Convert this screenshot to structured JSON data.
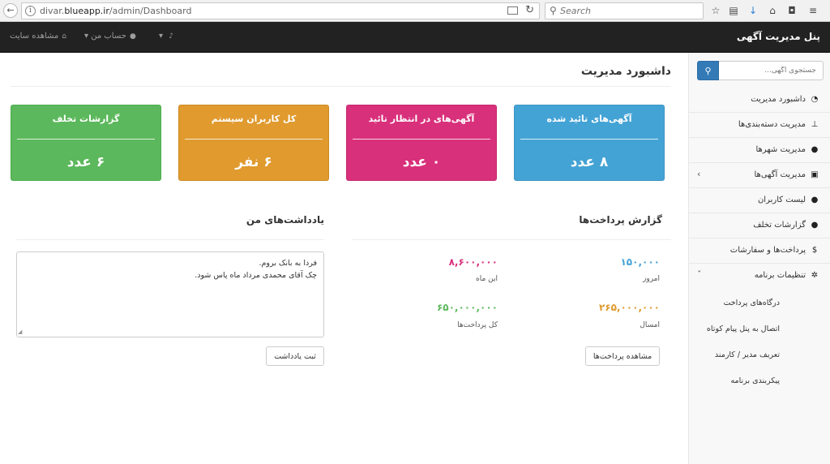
{
  "browser": {
    "url_prefix": "divar.",
    "url_domain": "blueapp.ir",
    "url_path": "/admin/Dashboard",
    "search_placeholder": "Search",
    "back_icon": "back-arrow-icon",
    "info_icon": "info-icon"
  },
  "topbar": {
    "brand": "پنل مدیریت آگهی",
    "view_site": "مشاهده سایت",
    "my_account": "حساب من",
    "caret": "▾",
    "bell_icon": "bell-icon"
  },
  "sidebar": {
    "search_placeholder": "جستجوی آگهی...",
    "items": [
      {
        "label": "داشبورد مدیریت",
        "icon": "dashboard-icon"
      },
      {
        "label": "مدیریت دسته‌بندی‌ها",
        "icon": "sitemap-icon"
      },
      {
        "label": "مدیریت شهرها",
        "icon": "map-marker-icon"
      },
      {
        "label": "مدیریت آگهی‌ها",
        "icon": "cubes-icon"
      },
      {
        "label": "لیست کاربران",
        "icon": "user-icon"
      },
      {
        "label": "گزارشات تخلف",
        "icon": "comment-icon"
      },
      {
        "label": "پرداخت‌ها و سفارشات",
        "icon": "dollar-icon"
      },
      {
        "label": "تنظیمات برنامه",
        "icon": "gear-icon"
      }
    ],
    "sub_items": [
      {
        "label": "درگاه‌های پرداخت"
      },
      {
        "label": "اتصال به پنل پیام کوتاه"
      },
      {
        "label": "تعریف مدیر / کارمند"
      },
      {
        "label": "پیکربندی برنامه"
      }
    ]
  },
  "main": {
    "title": "داشبورد مدیریت",
    "stats": [
      {
        "title": "آگهی‌های تائید شده",
        "value": "۸ عدد",
        "color": "#44a3d5"
      },
      {
        "title": "آگهی‌های در انتظار تائید",
        "value": "۰ عدد",
        "color": "#d9307b"
      },
      {
        "title": "کل کاربران سیستم",
        "value": "۶ نفر",
        "color": "#e09a2e"
      },
      {
        "title": "گزارشات تخلف",
        "value": "۶ عدد",
        "color": "#5cb85c"
      }
    ],
    "payments": {
      "title": "گزارش پرداخت‌ها",
      "today_value": "۱۵۰,۰۰۰",
      "today_label": "امروز",
      "month_value": "۸,۶۰۰,۰۰۰",
      "month_label": "این ماه",
      "year_value": "۲۶۵,۰۰۰,۰۰۰",
      "year_label": "امسال",
      "total_value": "۶۵۰,۰۰۰,۰۰۰",
      "total_label": "کل پرداخت‌ها",
      "button": "مشاهده پرداخت‌ها"
    },
    "notes": {
      "title": "یادداشت‌های من",
      "text": "فردا به بانک بروم.\nچک آقای محمدی مرداد ماه پاس شود.",
      "button": "ثبت یادداشت"
    }
  }
}
